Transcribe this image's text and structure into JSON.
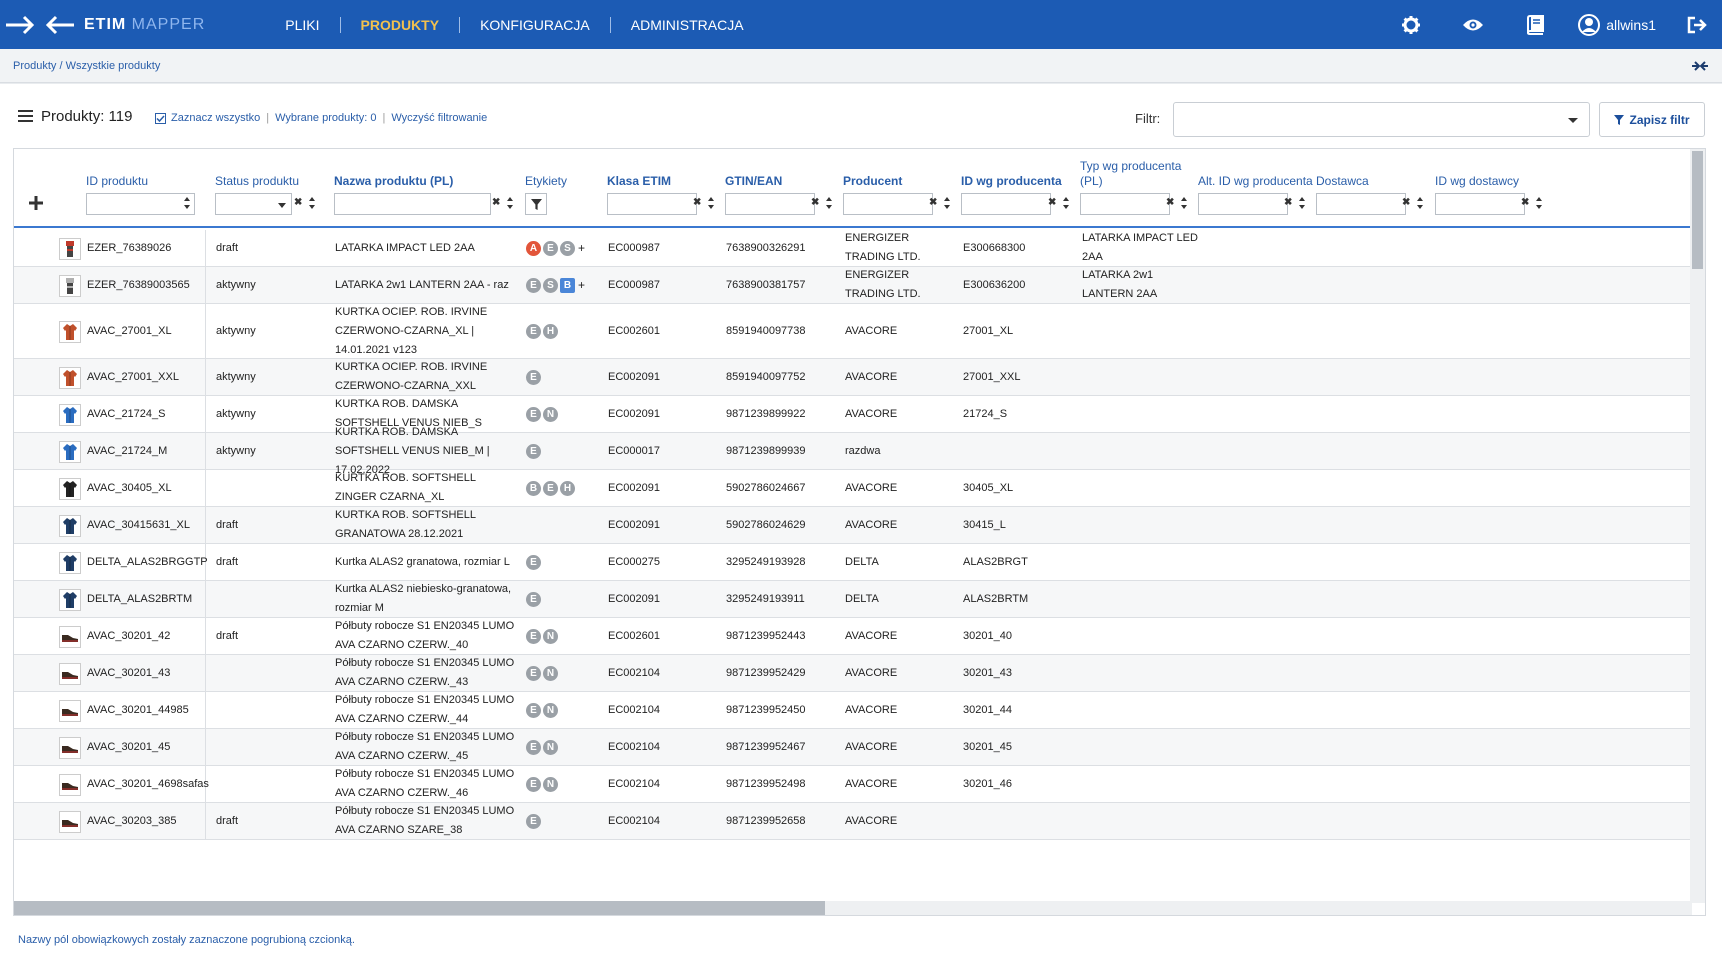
{
  "app": {
    "logo_main": "ETIM",
    "logo_accent": "MAPPER",
    "nav": [
      "PLIKI",
      "PRODUKTY",
      "KONFIGURACJA",
      "ADMINISTRACJA"
    ],
    "active_nav": "PRODUKTY",
    "username": "allwins1",
    "colors": {
      "navbar": "#1c5bb4",
      "active": "#f2c14e",
      "link": "#2a5ea9"
    }
  },
  "breadcrumb": "Produkty / Wszystkie produkty",
  "header": {
    "title": "Produkty: 119",
    "select_all": "Zaznacz wszystko",
    "selected": "Wybrane produkty: 0",
    "clear_filter": "Wyczyść filtrowanie",
    "filter_label": "Filtr:",
    "filter_value": "",
    "save_filter": "Zapisz filtr"
  },
  "columns": [
    "ID produktu",
    "Status produktu",
    "Nazwa produktu (PL)",
    "Etykiety",
    "Klasa ETIM",
    "GTIN/EAN",
    "Producent",
    "ID wg producenta",
    "Typ wg producenta (PL)",
    "Alt. ID wg producenta",
    "Dostawca",
    "ID wg dostawcy"
  ],
  "rows": [
    {
      "id": "EZER_76389026",
      "status": "draft",
      "name": "LATARKA IMPACT LED 2AA",
      "tags": [
        "A:red",
        "E:grey",
        "S:grey"
      ],
      "more": "+",
      "etim": "EC000987",
      "gtin": "7638900326291",
      "producer": "ENERGIZER TRADING LTD.",
      "mfr_id": "E300668300",
      "mfr_type": "LATARKA IMPACT LED 2AA",
      "icon": "flashlight"
    },
    {
      "id": "EZER_76389003565",
      "status": "aktywny",
      "name": "LATARKA 2w1 LANTERN 2AA - raz",
      "tags": [
        "E:grey",
        "S:grey",
        "B:blue"
      ],
      "more": "+",
      "etim": "EC000987",
      "gtin": "7638900381757",
      "producer": "ENERGIZER TRADING LTD.",
      "mfr_id": "E300636200",
      "mfr_type": "LATARKA 2w1 LANTERN 2AA",
      "icon": "lantern"
    },
    {
      "id": "AVAC_27001_XL",
      "status": "aktywny",
      "name": "KURTKA OCIEP. ROB. IRVINE CZERWONO-CZARNA_XL | 14.01.2021 v123",
      "tags": [
        "E:grey",
        "H:grey"
      ],
      "more": "",
      "etim": "EC002601",
      "gtin": "8591940097738",
      "producer": "AVACORE",
      "mfr_id": "27001_XL",
      "mfr_type": "",
      "icon": "jacket-red"
    },
    {
      "id": "AVAC_27001_XXL",
      "status": "aktywny",
      "name": "KURTKA OCIEP. ROB. IRVINE CZERWONO-CZARNA_XXL",
      "tags": [
        "E:grey"
      ],
      "more": "",
      "etim": "EC002091",
      "gtin": "8591940097752",
      "producer": "AVACORE",
      "mfr_id": "27001_XXL",
      "mfr_type": "",
      "icon": "jacket-red"
    },
    {
      "id": "AVAC_21724_S",
      "status": "aktywny",
      "name": "KURTKA ROB. DAMSKA SOFTSHELL VENUS NIEB_S",
      "tags": [
        "E:grey",
        "N:grey"
      ],
      "more": "",
      "etim": "EC002091",
      "gtin": "9871239899922",
      "producer": "AVACORE",
      "mfr_id": "21724_S",
      "mfr_type": "",
      "icon": "jacket-blue"
    },
    {
      "id": "AVAC_21724_M",
      "status": "aktywny",
      "name": "KURTKA ROB. DAMSKA SOFTSHELL VENUS NIEB_M | 17.02.2022",
      "tags": [
        "E:grey"
      ],
      "more": "",
      "etim": "EC000017",
      "gtin": "9871239899939",
      "producer": "razdwa",
      "mfr_id": "",
      "mfr_type": "",
      "icon": "jacket-blue"
    },
    {
      "id": "AVAC_30405_XL",
      "status": "",
      "name": "KURTKA ROB. SOFTSHELL ZINGER CZARNA_XL",
      "tags": [
        "B:grey",
        "E:grey",
        "H:grey"
      ],
      "more": "",
      "etim": "EC002091",
      "gtin": "5902786024667",
      "producer": "AVACORE",
      "mfr_id": "30405_XL",
      "mfr_type": "",
      "icon": "jacket-black"
    },
    {
      "id": "AVAC_30415631_XL",
      "status": "draft",
      "name": "KURTKA ROB. SOFTSHELL GRANATOWA 28.12.2021",
      "tags": [],
      "more": "",
      "etim": "EC002091",
      "gtin": "5902786024629",
      "producer": "AVACORE",
      "mfr_id": "30415_L",
      "mfr_type": "",
      "icon": "jacket-navy"
    },
    {
      "id": "DELTA_ALAS2BRGGTP",
      "status": "draft",
      "name": "Kurtka ALAS2 granatowa, rozmiar L",
      "tags": [
        "E:grey"
      ],
      "more": "",
      "etim": "EC000275",
      "gtin": "3295249193928",
      "producer": "DELTA",
      "mfr_id": "ALAS2BRGT",
      "mfr_type": "",
      "icon": "jacket-navy"
    },
    {
      "id": "DELTA_ALAS2BRTM",
      "status": "",
      "name": "Kurtka ALAS2 niebiesko-granatowa, rozmiar M",
      "tags": [
        "E:grey"
      ],
      "more": "",
      "etim": "EC002091",
      "gtin": "3295249193911",
      "producer": "DELTA",
      "mfr_id": "ALAS2BRTM",
      "mfr_type": "",
      "icon": "jacket-navy"
    },
    {
      "id": "AVAC_30201_42",
      "status": "draft",
      "name": "Półbuty robocze S1 EN20345 LUMO AVA CZARNO CZERW._40",
      "tags": [
        "E:grey",
        "N:grey"
      ],
      "more": "",
      "etim": "EC002601",
      "gtin": "9871239952443",
      "producer": "AVACORE",
      "mfr_id": "30201_40",
      "mfr_type": "",
      "icon": "shoe"
    },
    {
      "id": "AVAC_30201_43",
      "status": "",
      "name": "Półbuty robocze S1 EN20345 LUMO AVA CZARNO CZERW._43",
      "tags": [
        "E:grey",
        "N:grey"
      ],
      "more": "",
      "etim": "EC002104",
      "gtin": "9871239952429",
      "producer": "AVACORE",
      "mfr_id": "30201_43",
      "mfr_type": "",
      "icon": "shoe"
    },
    {
      "id": "AVAC_30201_44985",
      "status": "",
      "name": "Półbuty robocze S1 EN20345 LUMO AVA CZARNO CZERW._44",
      "tags": [
        "E:grey",
        "N:grey"
      ],
      "more": "",
      "etim": "EC002104",
      "gtin": "9871239952450",
      "producer": "AVACORE",
      "mfr_id": "30201_44",
      "mfr_type": "",
      "icon": "shoe"
    },
    {
      "id": "AVAC_30201_45",
      "status": "",
      "name": "Półbuty robocze S1 EN20345 LUMO AVA CZARNO CZERW._45",
      "tags": [
        "E:grey",
        "N:grey"
      ],
      "more": "",
      "etim": "EC002104",
      "gtin": "9871239952467",
      "producer": "AVACORE",
      "mfr_id": "30201_45",
      "mfr_type": "",
      "icon": "shoe"
    },
    {
      "id": "AVAC_30201_4698safas",
      "status": "",
      "name": "Półbuty robocze S1 EN20345 LUMO AVA CZARNO CZERW._46",
      "tags": [
        "E:grey",
        "N:grey"
      ],
      "more": "",
      "etim": "EC002104",
      "gtin": "9871239952498",
      "producer": "AVACORE",
      "mfr_id": "30201_46",
      "mfr_type": "",
      "icon": "shoe"
    },
    {
      "id": "AVAC_30203_385",
      "status": "draft",
      "name": "Półbuty robocze S1 EN20345 LUMO AVA CZARNO SZARE_38",
      "tags": [
        "E:grey"
      ],
      "more": "",
      "etim": "EC002104",
      "gtin": "9871239952658",
      "producer": "AVACORE",
      "mfr_id": "",
      "mfr_type": "",
      "icon": "shoe"
    }
  ],
  "footnote": "Nazwy pól obowiązkowych zostały zaznaczone pogrubioną czcionką."
}
